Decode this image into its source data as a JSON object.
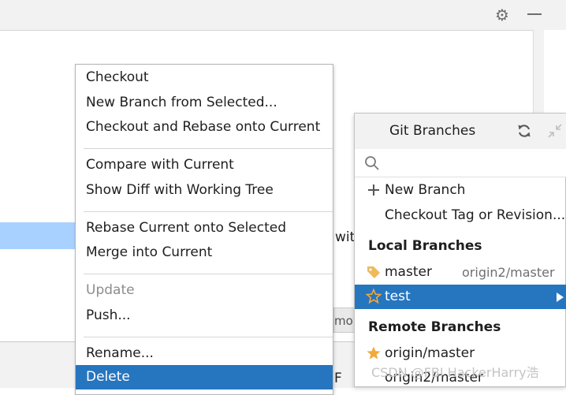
{
  "toolbar": {
    "settings_icon": "gear-icon",
    "minimize_icon": "minimize-icon"
  },
  "background": {
    "peek_text_1": "wit",
    "peek_text_2": "mo",
    "peek_text_3": "F"
  },
  "context_menu": {
    "groups": [
      [
        "Checkout",
        "New Branch from Selected...",
        "Checkout and Rebase onto Current"
      ],
      [
        "Compare with Current",
        "Show Diff with Working Tree"
      ],
      [
        "Rebase Current onto Selected",
        "Merge into Current"
      ],
      [
        "Update",
        "Push..."
      ],
      [
        "Rename...",
        "Delete"
      ]
    ],
    "disabled_items": [
      "Update"
    ],
    "highlighted_item": "Delete"
  },
  "git_branches": {
    "title": "Git Branches",
    "refresh_icon": "refresh-icon",
    "collapse_icon": "collapse-icon",
    "search_placeholder": "",
    "actions": {
      "new_branch": "New Branch",
      "checkout_tag": "Checkout Tag or Revision..."
    },
    "local_heading": "Local Branches",
    "local": [
      {
        "name": "master",
        "tracking": "origin2/master",
        "icon": "tag-icon"
      },
      {
        "name": "test",
        "tracking": "",
        "icon": "star-outline-icon",
        "selected": true
      }
    ],
    "remote_heading": "Remote Branches",
    "remote": [
      {
        "name": "origin/master",
        "icon": "star-filled-icon"
      },
      {
        "name": "origin2/master",
        "icon": ""
      }
    ]
  },
  "colors": {
    "selection": "#2675bf",
    "row_highlight": "#a8d1ff",
    "tag": "#f0b95a",
    "star": "#f2a93b"
  },
  "watermark": "CSDN @FBI HackerHarry浩"
}
